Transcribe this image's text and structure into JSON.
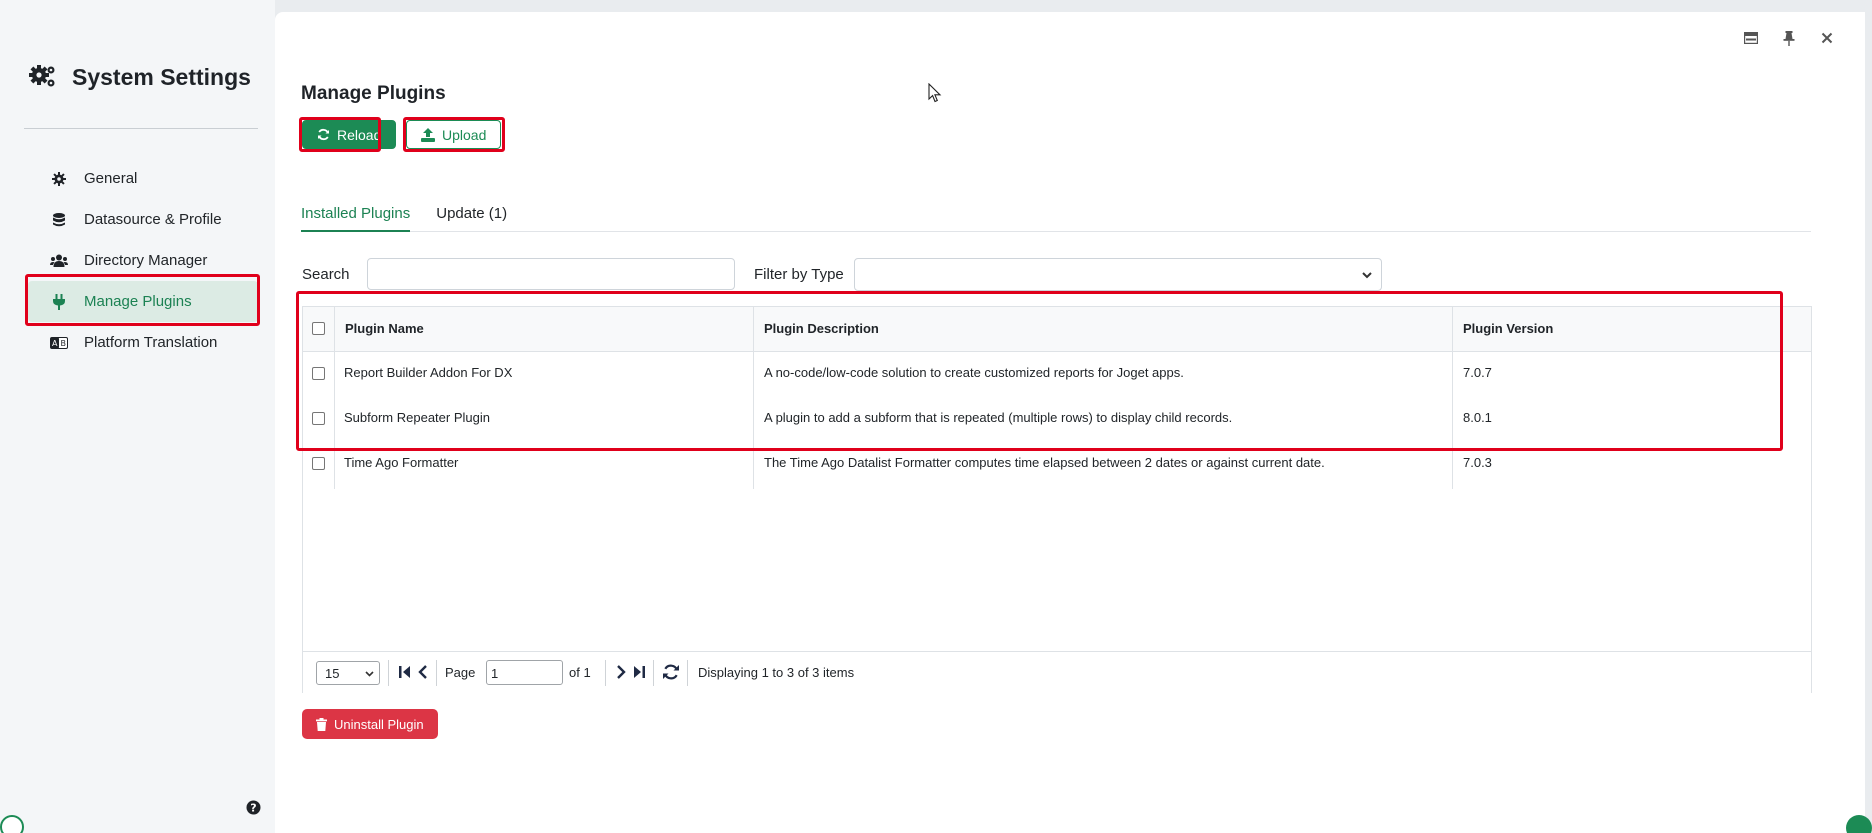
{
  "sidebar": {
    "title": "System Settings",
    "items": [
      {
        "label": "General",
        "icon": "gear-icon"
      },
      {
        "label": "Datasource & Profile",
        "icon": "database-icon"
      },
      {
        "label": "Directory Manager",
        "icon": "users-icon"
      },
      {
        "label": "Manage Plugins",
        "icon": "plug-icon",
        "active": true
      },
      {
        "label": "Platform Translation",
        "icon": "translate-icon"
      }
    ]
  },
  "main": {
    "title": "Manage Plugins",
    "reload_label": "Reload",
    "upload_label": "Upload",
    "tabs": [
      {
        "label": "Installed Plugins",
        "active": true
      },
      {
        "label": "Update (1)"
      }
    ],
    "search_label": "Search",
    "filter_label": "Filter by Type",
    "table": {
      "columns": [
        "Plugin Name",
        "Plugin Description",
        "Plugin Version"
      ],
      "rows": [
        {
          "name": "Report Builder Addon For DX",
          "description": "A no-code/low-code solution to create customized reports for Joget apps.",
          "version": "7.0.7"
        },
        {
          "name": "Subform Repeater Plugin",
          "description": "A plugin to add a subform that is repeated (multiple rows) to display child records.",
          "version": "8.0.1"
        },
        {
          "name": "Time Ago Formatter",
          "description": "The Time Ago Datalist Formatter computes time elapsed between 2 dates or against current date.",
          "version": "7.0.3"
        }
      ]
    },
    "pager": {
      "page_size": "15",
      "page_label": "Page",
      "page_value": "1",
      "of_label": "of 1",
      "display_text": "Displaying 1 to 3 of 3 items"
    },
    "uninstall_label": "Uninstall Plugin"
  },
  "colors": {
    "accent": "#1c8b55",
    "danger": "#dc3545",
    "highlight": "#e0001b"
  }
}
